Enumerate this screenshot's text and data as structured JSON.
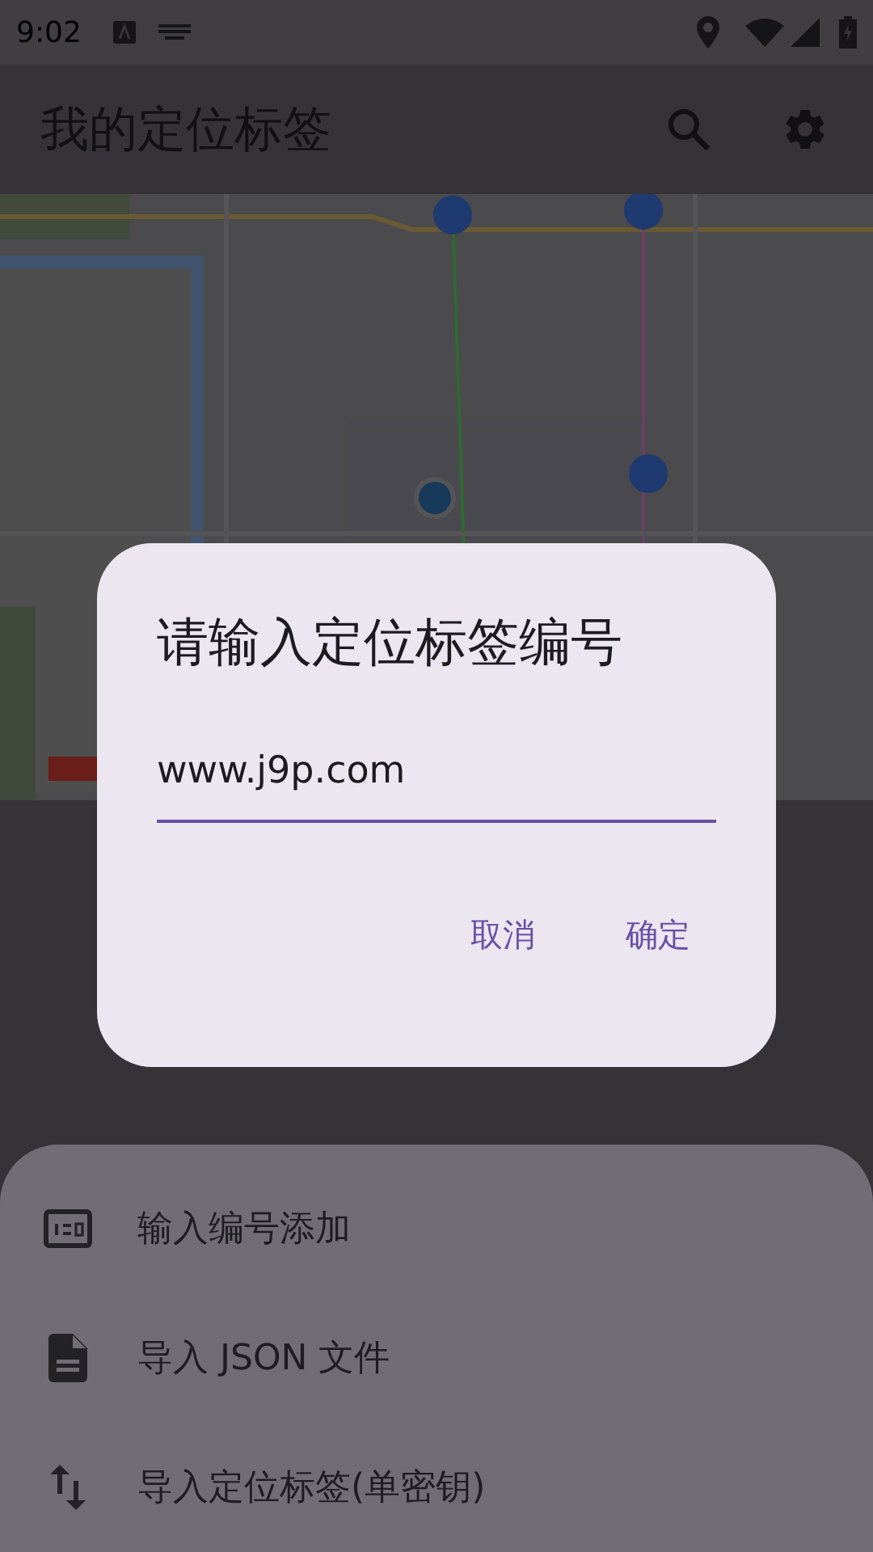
{
  "status_bar": {
    "time": "9:02"
  },
  "app_bar": {
    "title": "我的定位标签"
  },
  "dialog": {
    "title": "请输入定位标签编号",
    "input": {
      "value": "www.j9p.com"
    },
    "buttons": [
      "取消",
      "确定"
    ]
  },
  "bottom_sheet": {
    "items": [
      {
        "kind": "number",
        "label": "输入编号添加"
      },
      {
        "kind": "file",
        "label": "导入 JSON 文件"
      },
      {
        "kind": "swap",
        "label": "导入定位标签(单密钥)"
      }
    ]
  }
}
